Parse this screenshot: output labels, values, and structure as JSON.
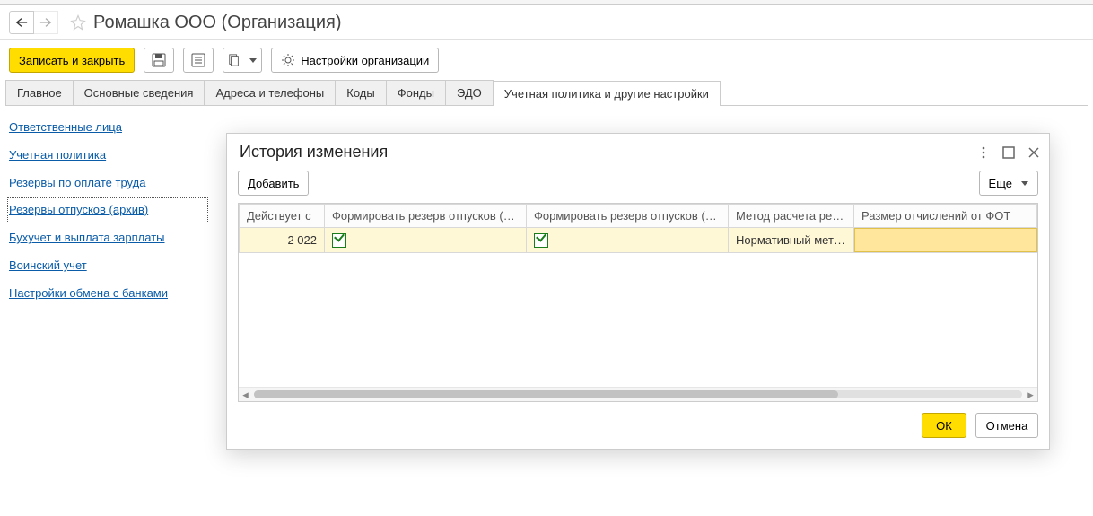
{
  "page_title": "Ромашка ООО (Организация)",
  "toolbar": {
    "save_close": "Записать и закрыть",
    "org_settings": "Настройки организации"
  },
  "tabs": [
    {
      "label": "Главное"
    },
    {
      "label": "Основные сведения"
    },
    {
      "label": "Адреса и телефоны"
    },
    {
      "label": "Коды"
    },
    {
      "label": "Фонды"
    },
    {
      "label": "ЭДО"
    },
    {
      "label": "Учетная политика и другие настройки"
    }
  ],
  "sidebar": {
    "items": [
      {
        "label": "Ответственные лица"
      },
      {
        "label": "Учетная политика"
      },
      {
        "label": "Резервы по оплате труда"
      },
      {
        "label": "Резервы отпусков (архив)"
      },
      {
        "label": "Бухучет и выплата зарплаты"
      },
      {
        "label": "Воинский учет"
      },
      {
        "label": "Настройки обмена с банками"
      }
    ]
  },
  "dialog": {
    "title": "История изменения",
    "add": "Добавить",
    "more": "Еще",
    "ok": "ОК",
    "cancel": "Отмена",
    "columns": {
      "effective_from": "Действует с",
      "reserve_bu": "Формировать резерв отпусков (БУ)",
      "reserve_nu": "Формировать резерв отпусков (НУ)",
      "method": "Метод расчета ре…",
      "size": "Размер отчислений от ФОТ"
    },
    "rows": [
      {
        "effective_from": "2 022",
        "reserve_bu": true,
        "reserve_nu": true,
        "method": "Нормативный мет…",
        "size": ""
      }
    ]
  }
}
